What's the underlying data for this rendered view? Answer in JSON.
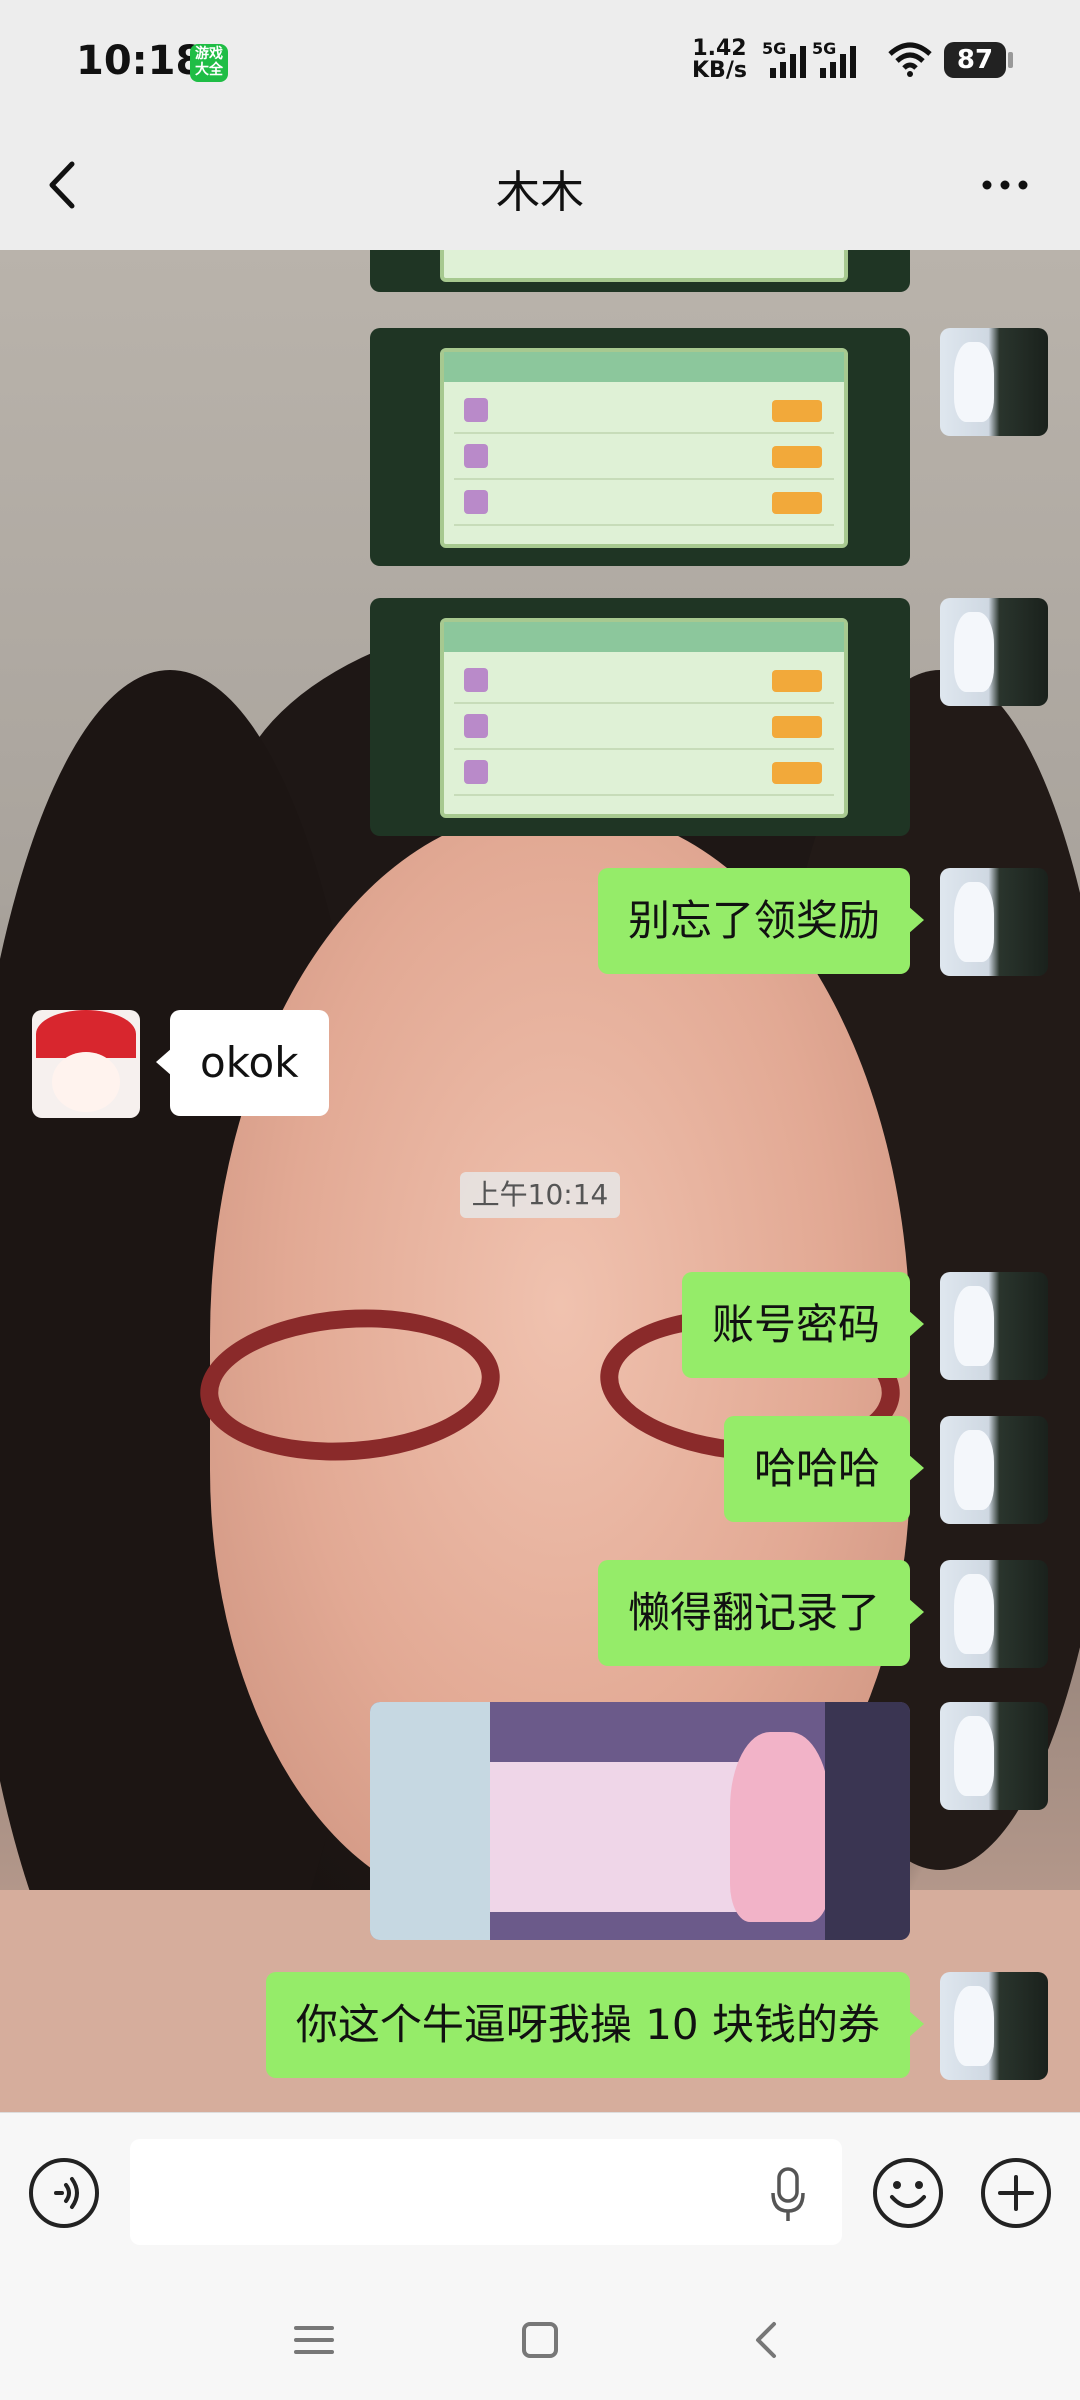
{
  "status_bar": {
    "time": "10:18",
    "game_badge": "游戏大全",
    "net_speed_value": "1.42",
    "net_speed_unit": "KB/s",
    "signal1_label": "5G",
    "signal2_label": "5G",
    "battery": "87"
  },
  "header": {
    "title": "木木",
    "back_icon": "chevron-left-icon",
    "more_icon": "ellipsis-icon"
  },
  "messages": [
    {
      "type": "image",
      "side": "self",
      "desc": "game screenshot"
    },
    {
      "type": "image",
      "side": "self",
      "desc": "game screenshot"
    },
    {
      "type": "image",
      "side": "self",
      "desc": "game screenshot"
    },
    {
      "type": "text",
      "side": "self",
      "text": "别忘了领奖励"
    },
    {
      "type": "text",
      "side": "other",
      "text": "okok"
    },
    {
      "type": "time",
      "text": "上午10:14"
    },
    {
      "type": "text",
      "side": "self",
      "text": "账号密码"
    },
    {
      "type": "text",
      "side": "self",
      "text": "哈哈哈"
    },
    {
      "type": "text",
      "side": "self",
      "text": "懒得翻记录了"
    },
    {
      "type": "image",
      "side": "self",
      "desc": "game shop screenshot"
    },
    {
      "type": "text",
      "side": "self",
      "text": "你这个牛逼呀我操 10 块钱的券"
    }
  ],
  "input_bar": {
    "placeholder": "",
    "voice_icon": "voice-icon",
    "mic_icon": "mic-icon",
    "emoji_icon": "emoji-icon",
    "plus_icon": "plus-icon"
  },
  "nav_bar": {
    "menu_icon": "menu-icon",
    "home_icon": "home-icon",
    "back_icon": "back-icon"
  },
  "colors": {
    "bubble_self": "#95ec69",
    "bubble_other": "#ffffff",
    "bar_bg": "#ededed"
  }
}
